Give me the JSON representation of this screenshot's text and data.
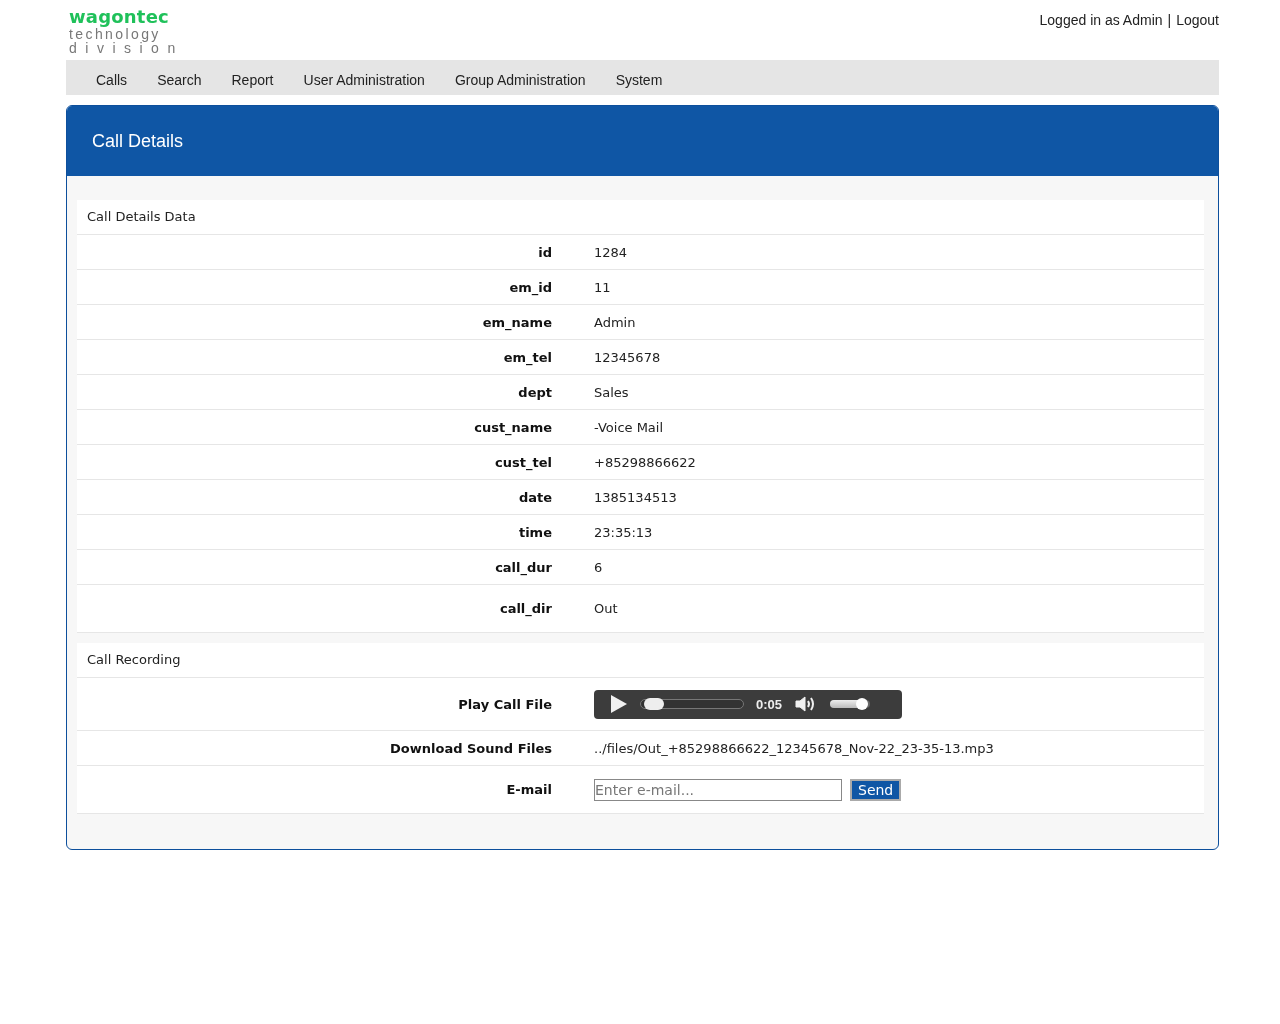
{
  "logo": {
    "brand": "wagontec",
    "line_1": "technology",
    "line_2": "division"
  },
  "user_bar": {
    "status": "Logged in as Admin",
    "separator": "|",
    "logout": "Logout"
  },
  "nav": [
    {
      "label": "Calls"
    },
    {
      "label": "Search"
    },
    {
      "label": "Report"
    },
    {
      "label": "User Administration"
    },
    {
      "label": "Group Administration"
    },
    {
      "label": "System"
    }
  ],
  "panel": {
    "title": "Call Details"
  },
  "details": {
    "heading": "Call Details Data",
    "rows": [
      {
        "label": "id",
        "value": "1284"
      },
      {
        "label": "em_id",
        "value": "11"
      },
      {
        "label": "em_name",
        "value": "Admin"
      },
      {
        "label": "em_tel",
        "value": "12345678"
      },
      {
        "label": "dept",
        "value": "Sales"
      },
      {
        "label": "cust_name",
        "value": "-Voice Mail"
      },
      {
        "label": "cust_tel",
        "value": "+85298866622"
      },
      {
        "label": "date",
        "value": "1385134513"
      },
      {
        "label": "time",
        "value": "23:35:13"
      },
      {
        "label": "call_dur",
        "value": "6"
      },
      {
        "label": "call_dir",
        "value": "Out"
      }
    ]
  },
  "recording": {
    "heading": "Call Recording",
    "rows": [
      {
        "kind": "player",
        "label": "Play Call File",
        "time": "0:05",
        "progress": {
          "level": 0.05
        },
        "volume": {
          "level": 0.85
        }
      },
      {
        "kind": "text",
        "label": "Download Sound Files",
        "value": "../files/Out_+85298866622_12345678_Nov-22_23-35-13.mp3"
      },
      {
        "kind": "email",
        "label": "E-mail",
        "placeholder": "Enter e-mail...",
        "button": "Send"
      }
    ]
  }
}
